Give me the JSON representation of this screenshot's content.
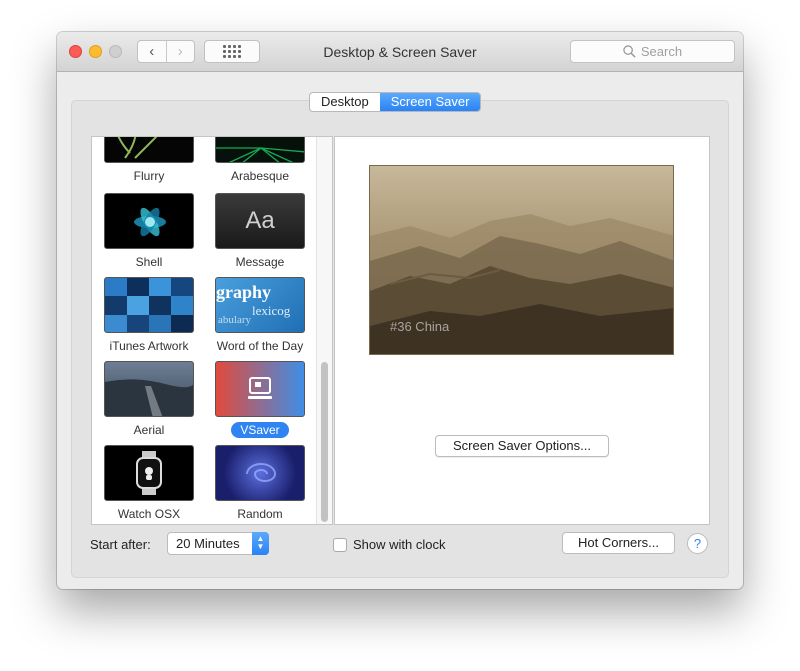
{
  "window": {
    "title": "Desktop & Screen Saver"
  },
  "toolbar": {
    "back_icon": "chevron-left-icon",
    "forward_icon": "chevron-right-icon",
    "grid_icon": "grid-icon"
  },
  "search": {
    "placeholder": "Search"
  },
  "tabs": [
    {
      "label": "Desktop",
      "active": false
    },
    {
      "label": "Screen Saver",
      "active": true
    }
  ],
  "savers": [
    {
      "label": "Flurry",
      "selected": false
    },
    {
      "label": "Arabesque",
      "selected": false
    },
    {
      "label": "Shell",
      "selected": false
    },
    {
      "label": "Message",
      "selected": false,
      "thumb_text": "Aa"
    },
    {
      "label": "iTunes Artwork",
      "selected": false
    },
    {
      "label": "Word of the Day",
      "selected": false,
      "thumb_text": "graphy",
      "thumb_text2": "lexicog",
      "thumb_text3": "abulary"
    },
    {
      "label": "Aerial",
      "selected": false
    },
    {
      "label": "VSaver",
      "selected": true
    },
    {
      "label": "Watch OSX",
      "selected": false
    },
    {
      "label": "Random",
      "selected": false
    }
  ],
  "preview": {
    "caption": "#36 China",
    "options_button": "Screen Saver Options..."
  },
  "bottom": {
    "start_after_label": "Start after:",
    "start_after_value": "20 Minutes",
    "show_clock_label": "Show with clock",
    "show_clock_checked": false,
    "hot_corners_label": "Hot Corners...",
    "help_label": "?"
  },
  "colors": {
    "accent": "#2f84f2",
    "close": "#fc5b57",
    "minimize": "#fdbc2e"
  }
}
